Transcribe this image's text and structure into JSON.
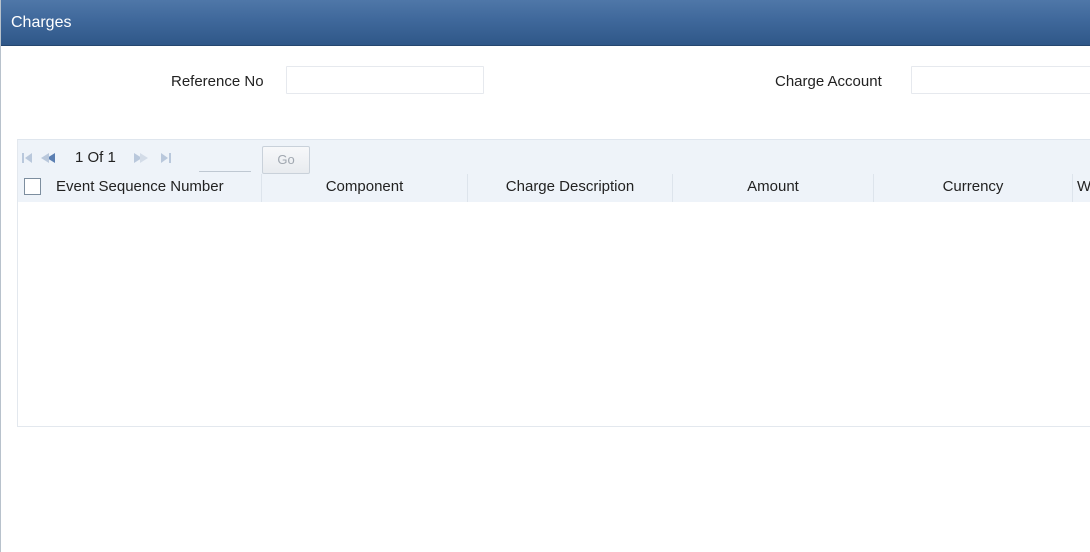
{
  "window": {
    "title": "Charges"
  },
  "form": {
    "reference_no_label": "Reference No",
    "reference_no_value": "",
    "charge_account_label": "Charge Account",
    "charge_account_value": ""
  },
  "grid": {
    "pager": {
      "page_info": "1 Of 1",
      "page_input_value": "",
      "go_label": "Go",
      "icons": [
        "first-page-icon",
        "previous-page-icon",
        "next-page-icon",
        "last-page-icon"
      ]
    },
    "columns": [
      "Event Sequence Number",
      "Component",
      "Charge Description",
      "Amount",
      "Currency",
      "W"
    ],
    "rows": []
  },
  "colors": {
    "titlebar": "#3f689b",
    "header_bg": "#eef3f9",
    "nav_active": "#5b7fb2",
    "nav_disabled": "#b9c8dc"
  }
}
